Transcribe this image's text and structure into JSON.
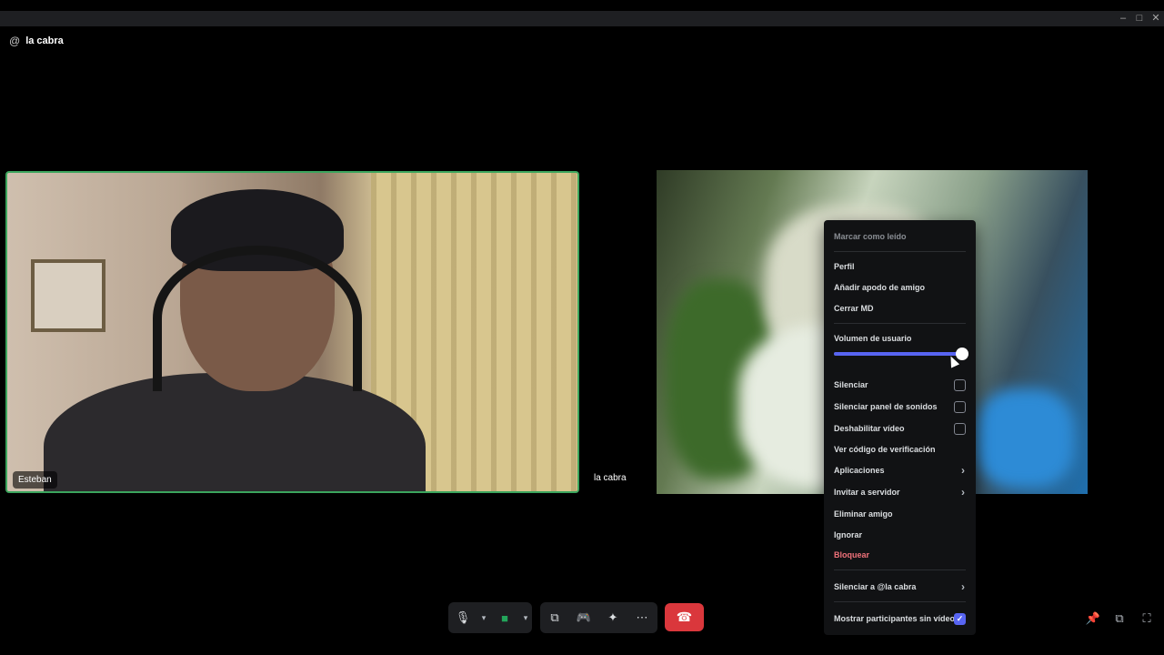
{
  "window": {
    "minimize_icon": "minimize-icon",
    "maximize_icon": "maximize-icon",
    "close_icon": "close-icon"
  },
  "header": {
    "channel_icon": "at-icon",
    "channel_name": "la cabra"
  },
  "tiles": {
    "local": {
      "name": "Esteban",
      "speaking_border_color": "#3ba55d"
    },
    "remote": {
      "name": "la cabra"
    }
  },
  "context_menu": {
    "mark_read": "Marcar como leído",
    "profile": "Perfil",
    "add_nickname": "Añadir apodo de amigo",
    "close_dm": "Cerrar MD",
    "user_volume_label": "Volumen de usuario",
    "user_volume_percent": 100,
    "mute": "Silenciar",
    "mute_soundboard": "Silenciar panel de sonidos",
    "disable_video": "Deshabilitar vídeo",
    "verification_code": "Ver código de verificación",
    "apps": "Aplicaciones",
    "invite_server": "Invitar a servidor",
    "remove_friend": "Eliminar amigo",
    "ignore": "Ignorar",
    "block": "Bloquear",
    "mute_user": "Silenciar a @la cabra",
    "show_no_video": "Mostrar participantes sin vídeo",
    "checkbox_states": {
      "mute": false,
      "mute_soundboard": false,
      "disable_video": false,
      "show_no_video": true
    },
    "accent_color": "#5865f2",
    "danger_color": "#f0727a"
  },
  "controls": {
    "mic_icon": "microphone-icon",
    "camera_icon": "camera-icon",
    "screenshare_icon": "screen-share-icon",
    "activity_icon": "gamepad-icon",
    "soundboard_icon": "soundboard-icon",
    "more_icon": "more-icon",
    "hangup_icon": "hang-up-icon",
    "hangup_color": "#da373c",
    "pin_icon": "pin-icon",
    "popout_icon": "popout-icon",
    "fullscreen_icon": "fullscreen-icon"
  }
}
